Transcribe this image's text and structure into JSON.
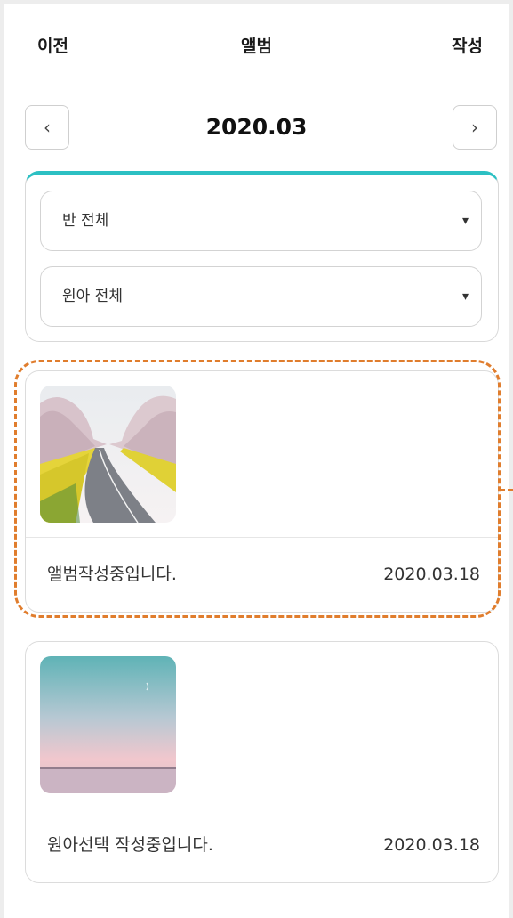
{
  "header": {
    "prev_label": "이전",
    "title": "앨범",
    "write_label": "작성"
  },
  "month_nav": {
    "prev_icon": "‹",
    "month": "2020.03",
    "next_icon": "›"
  },
  "filters": {
    "class_select": {
      "value": "반 전체",
      "arrow": "▾"
    },
    "child_select": {
      "value": "원아 전체",
      "arrow": "▾"
    }
  },
  "posts": [
    {
      "caption": "앨범작성중입니다.",
      "date": "2020.03.18",
      "thumbnail": "road-with-cherry-blossoms-and-canola-flowers"
    },
    {
      "caption": "원아선택 작성중입니다.",
      "date": "2020.03.18",
      "thumbnail": "pastel-sky-over-sea"
    }
  ],
  "colors": {
    "accent": "#2cc0c3",
    "highlight": "#e07d2d"
  }
}
